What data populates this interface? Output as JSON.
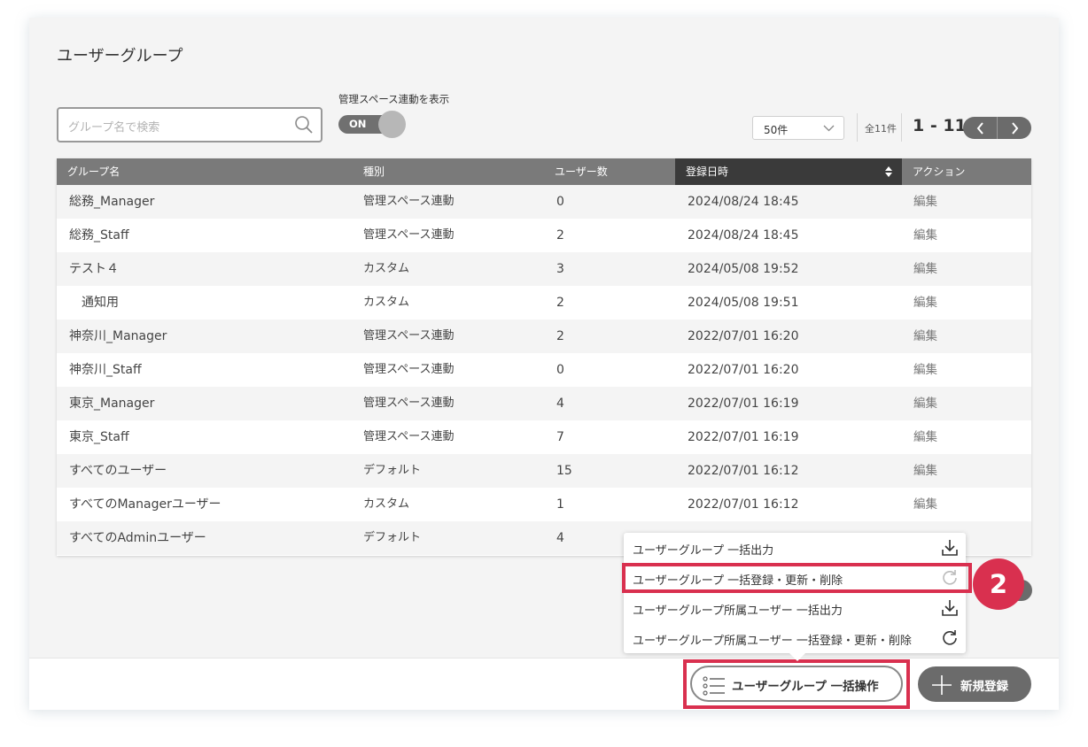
{
  "page": {
    "title": "ユーザーグループ"
  },
  "search": {
    "placeholder": "グループ名で検索"
  },
  "toggle": {
    "label": "管理スペース連動を表示",
    "state": "ON"
  },
  "pagination": {
    "per_page": "50件",
    "total": "全11件",
    "range": "1 - 11"
  },
  "table": {
    "columns": [
      "グループ名",
      "種別",
      "ユーザー数",
      "登録日時",
      "アクション"
    ],
    "sorted_column": "登録日時",
    "rows": [
      {
        "name": "総務_Manager",
        "type": "管理スペース連動",
        "users": "0",
        "date": "2024/08/24 18:45",
        "action": "編集"
      },
      {
        "name": "総務_Staff",
        "type": "管理スペース連動",
        "users": "2",
        "date": "2024/08/24 18:45",
        "action": "編集"
      },
      {
        "name": "テスト４",
        "type": "カスタム",
        "users": "3",
        "date": "2024/05/08 19:52",
        "action": "編集"
      },
      {
        "name": "　通知用",
        "type": "カスタム",
        "users": "2",
        "date": "2024/05/08 19:51",
        "action": "編集"
      },
      {
        "name": "神奈川_Manager",
        "type": "管理スペース連動",
        "users": "2",
        "date": "2022/07/01 16:20",
        "action": "編集"
      },
      {
        "name": "神奈川_Staff",
        "type": "管理スペース連動",
        "users": "0",
        "date": "2022/07/01 16:20",
        "action": "編集"
      },
      {
        "name": "東京_Manager",
        "type": "管理スペース連動",
        "users": "4",
        "date": "2022/07/01 16:19",
        "action": "編集"
      },
      {
        "name": "東京_Staff",
        "type": "管理スペース連動",
        "users": "7",
        "date": "2022/07/01 16:19",
        "action": "編集"
      },
      {
        "name": "すべてのユーザー",
        "type": "デフォルト",
        "users": "15",
        "date": "2022/07/01 16:12",
        "action": "編集"
      },
      {
        "name": "すべてのManagerユーザー",
        "type": "カスタム",
        "users": "1",
        "date": "2022/07/01 16:12",
        "action": "編集"
      },
      {
        "name": "すべてのAdminユーザー",
        "type": "デフォルト",
        "users": "4",
        "date": "",
        "action": ""
      }
    ]
  },
  "bulk_menu": {
    "items": [
      {
        "label": "ユーザーグループ 一括出力",
        "icon": "download-icon"
      },
      {
        "label": "ユーザーグループ 一括登録・更新・削除",
        "icon": "refresh-icon"
      },
      {
        "label": "ユーザーグループ所属ユーザー 一括出力",
        "icon": "download-icon"
      },
      {
        "label": "ユーザーグループ所属ユーザー 一括登録・更新・削除",
        "icon": "refresh-icon"
      }
    ]
  },
  "footer": {
    "bulk_button": "ユーザーグループ 一括操作",
    "new_button": "新規登録"
  },
  "annotation": {
    "badge": "2"
  },
  "colors": {
    "highlight": "#d9304f",
    "header": "#7a7a7a",
    "sorted_header": "#3a3a3a",
    "button": "#6b6b6b"
  }
}
